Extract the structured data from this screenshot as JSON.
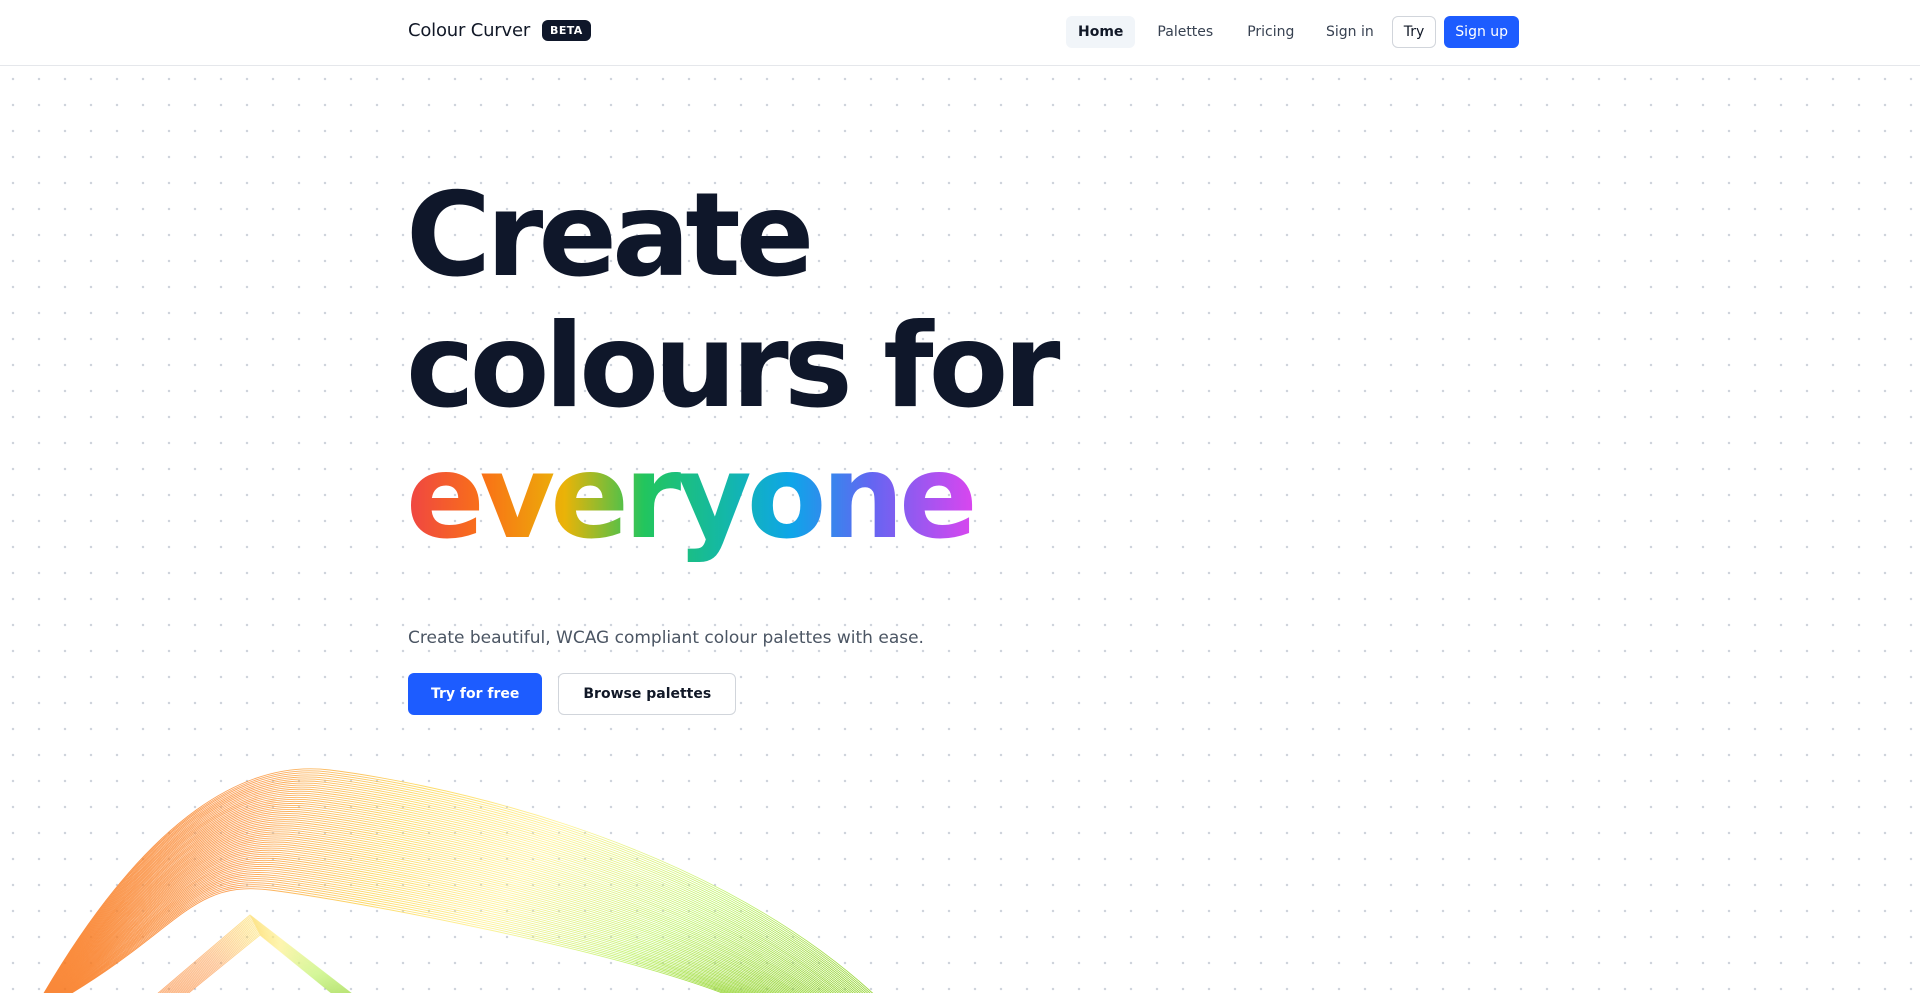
{
  "header": {
    "brand_name": "Colour Curver",
    "badge": "BETA",
    "nav": [
      {
        "label": "Home",
        "active": true
      },
      {
        "label": "Palettes",
        "active": false
      },
      {
        "label": "Pricing",
        "active": false
      }
    ],
    "sign_in": "Sign in",
    "try": "Try",
    "sign_up": "Sign up"
  },
  "hero": {
    "line1": "Create",
    "line2": "colours for",
    "line3": "everyone",
    "subtitle": "Create beautiful, WCAG compliant colour palettes with ease.",
    "primary_cta": "Try for free",
    "secondary_cta": "Browse palettes"
  },
  "colors": {
    "accent": "#1d5cff",
    "heading": "#0f172a",
    "rainbow": [
      "#ef4444",
      "#f97316",
      "#eab308",
      "#22c55e",
      "#14b8a6",
      "#0ea5e9",
      "#6366f1",
      "#d946ef"
    ],
    "wave_gradient": [
      "#f97316",
      "#fbbf24",
      "#fde68a",
      "#bef264",
      "#84cc16"
    ]
  }
}
